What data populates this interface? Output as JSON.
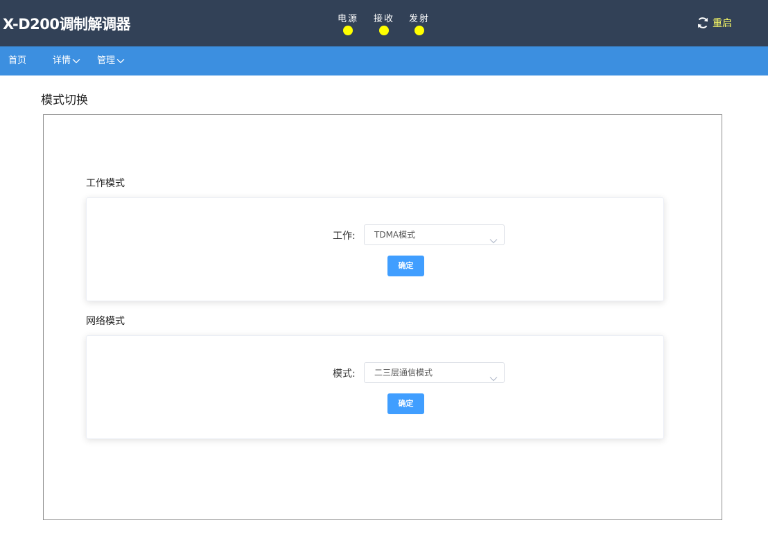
{
  "header": {
    "title": "X-D200调制解调器",
    "indicators": [
      {
        "label": "电源",
        "color": "#ffff00"
      },
      {
        "label": "接收",
        "color": "#ffff00"
      },
      {
        "label": "发射",
        "color": "#ffff00"
      }
    ],
    "restart_label": "重启",
    "restart_color": "#ffff66"
  },
  "nav": {
    "items": [
      {
        "label": "首页"
      },
      {
        "label": "详情"
      },
      {
        "label": "管理"
      }
    ]
  },
  "page": {
    "title": "模式切换"
  },
  "work_mode": {
    "section_title": "工作模式",
    "field_label": "工作:",
    "selected": "TDMA模式",
    "confirm_label": "确定"
  },
  "network_mode": {
    "section_title": "网络模式",
    "field_label": "模式:",
    "selected": "二三层通信模式",
    "confirm_label": "确定"
  },
  "colors": {
    "header_bg": "#324157",
    "nav_bg": "#3c8fe0",
    "button_bg": "#409eff"
  }
}
